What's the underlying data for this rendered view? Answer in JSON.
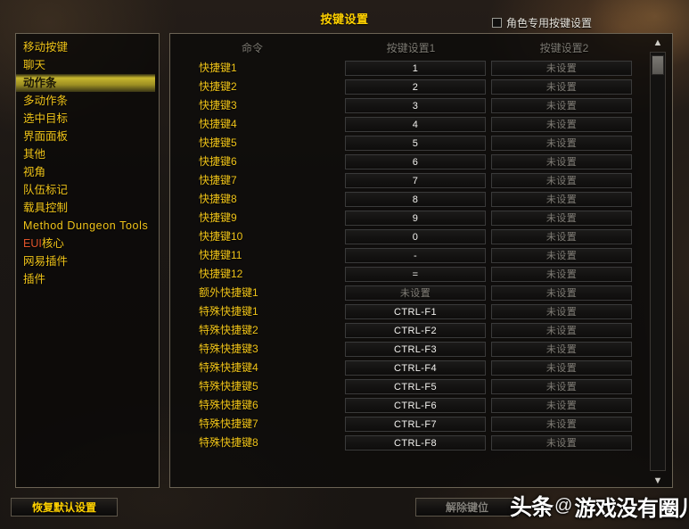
{
  "header": {
    "title": "按键设置",
    "character_specific_label": "角色专用按键设置",
    "character_specific_checked": false
  },
  "sidebar": {
    "items": [
      {
        "label": "移动按键",
        "selected": false
      },
      {
        "label": "聊天",
        "selected": false
      },
      {
        "label": "动作条",
        "selected": true
      },
      {
        "label": "多动作条",
        "selected": false
      },
      {
        "label": "选中目标",
        "selected": false
      },
      {
        "label": "界面面板",
        "selected": false
      },
      {
        "label": "其他",
        "selected": false
      },
      {
        "label": "视角",
        "selected": false
      },
      {
        "label": "队伍标记",
        "selected": false
      },
      {
        "label": "载具控制",
        "selected": false
      },
      {
        "label": "Method Dungeon Tools",
        "selected": false
      },
      {
        "label": "EUI核心",
        "selected": false,
        "prefix_red": "EUI",
        "suffix": "核心"
      },
      {
        "label": "网易插件",
        "selected": false
      },
      {
        "label": "插件",
        "selected": false
      }
    ]
  },
  "table": {
    "columns": {
      "command": "命令",
      "binding1": "按键设置1",
      "binding2": "按键设置2"
    },
    "unset_text": "未设置",
    "rows": [
      {
        "command": "快捷键1",
        "binding1": "1",
        "binding2": "未设置"
      },
      {
        "command": "快捷键2",
        "binding1": "2",
        "binding2": "未设置"
      },
      {
        "command": "快捷键3",
        "binding1": "3",
        "binding2": "未设置"
      },
      {
        "command": "快捷键4",
        "binding1": "4",
        "binding2": "未设置"
      },
      {
        "command": "快捷键5",
        "binding1": "5",
        "binding2": "未设置"
      },
      {
        "command": "快捷键6",
        "binding1": "6",
        "binding2": "未设置"
      },
      {
        "command": "快捷键7",
        "binding1": "7",
        "binding2": "未设置"
      },
      {
        "command": "快捷键8",
        "binding1": "8",
        "binding2": "未设置"
      },
      {
        "command": "快捷键9",
        "binding1": "9",
        "binding2": "未设置"
      },
      {
        "command": "快捷键10",
        "binding1": "0",
        "binding2": "未设置"
      },
      {
        "command": "快捷键11",
        "binding1": "-",
        "binding2": "未设置"
      },
      {
        "command": "快捷键12",
        "binding1": "=",
        "binding2": "未设置"
      },
      {
        "command": "额外快捷键1",
        "binding1": "未设置",
        "binding2": "未设置"
      },
      {
        "command": "特殊快捷键1",
        "binding1": "CTRL-F1",
        "binding2": "未设置"
      },
      {
        "command": "特殊快捷键2",
        "binding1": "CTRL-F2",
        "binding2": "未设置"
      },
      {
        "command": "特殊快捷键3",
        "binding1": "CTRL-F3",
        "binding2": "未设置"
      },
      {
        "command": "特殊快捷键4",
        "binding1": "CTRL-F4",
        "binding2": "未设置"
      },
      {
        "command": "特殊快捷键5",
        "binding1": "CTRL-F5",
        "binding2": "未设置"
      },
      {
        "command": "特殊快捷键6",
        "binding1": "CTRL-F6",
        "binding2": "未设置"
      },
      {
        "command": "特殊快捷键7",
        "binding1": "CTRL-F7",
        "binding2": "未设置"
      },
      {
        "command": "特殊快捷键8",
        "binding1": "CTRL-F8",
        "binding2": "未设置"
      }
    ]
  },
  "scrollbar": {
    "up_icon": "▲",
    "down_icon": "▼"
  },
  "footer": {
    "reset_label": "恢复默认设置",
    "unbind_label": "解除键位"
  },
  "watermark": {
    "brand": "头条",
    "at": "@",
    "handle": "游戏没有圈儿"
  },
  "colors": {
    "gold": "#ffd100",
    "item_gold": "#f0c419",
    "highlight": "#c8b72e",
    "red": "#e0542b",
    "unset_gray": "#807d76"
  }
}
